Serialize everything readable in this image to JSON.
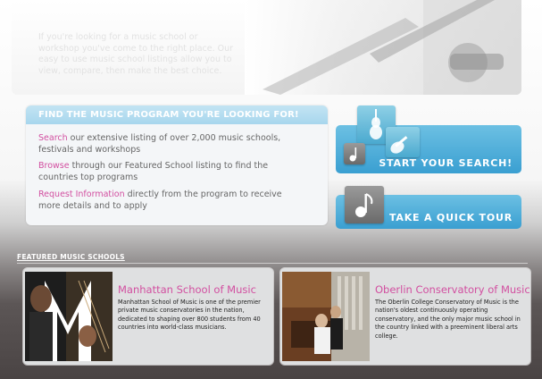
{
  "hero": {
    "intro_text": "If you're looking for a music school or workshop you've come to the right place. Our easy to use music school listings allow you to view, compare, then make the best choice."
  },
  "finder": {
    "title": "FIND THE MUSIC PROGRAM YOU'RE LOOKING FOR!",
    "items": [
      {
        "link": "Search",
        "text": " our extensive listing of over 2,000 music schools, festivals and workshops"
      },
      {
        "link": "Browse",
        "text": " through our Featured School listing to find the countries top programs"
      },
      {
        "link": "Request Information",
        "text": " directly from the program to receive more details and to apply"
      }
    ]
  },
  "buttons": {
    "search_label": "START YOUR SEARCH!",
    "tour_label": "TAKE A QUICK TOUR"
  },
  "featured": {
    "label": "FEATURED MUSIC SCHOOLS",
    "schools": [
      {
        "name": "Manhattan School of Music",
        "description": "Manhattan School of Music is one of the premier private music conservatories in the nation, dedicated to shaping over 800 students from 40 countries into world-class musicians."
      },
      {
        "name": "Oberlin Conservatory of Music",
        "description": "The Oberlin College Conservatory of Music is the nation's oldest continuously operating conservatory, and the only major music school in the country linked with a preeminent liberal arts college."
      }
    ]
  },
  "icons": {
    "violin": "violin-icon",
    "guitar": "guitar-icon",
    "music_note": "music-note-icon"
  },
  "colors": {
    "accent_pink": "#d24fa0",
    "button_blue": "#3a9fd1",
    "header_blue": "#a7d6ed"
  }
}
